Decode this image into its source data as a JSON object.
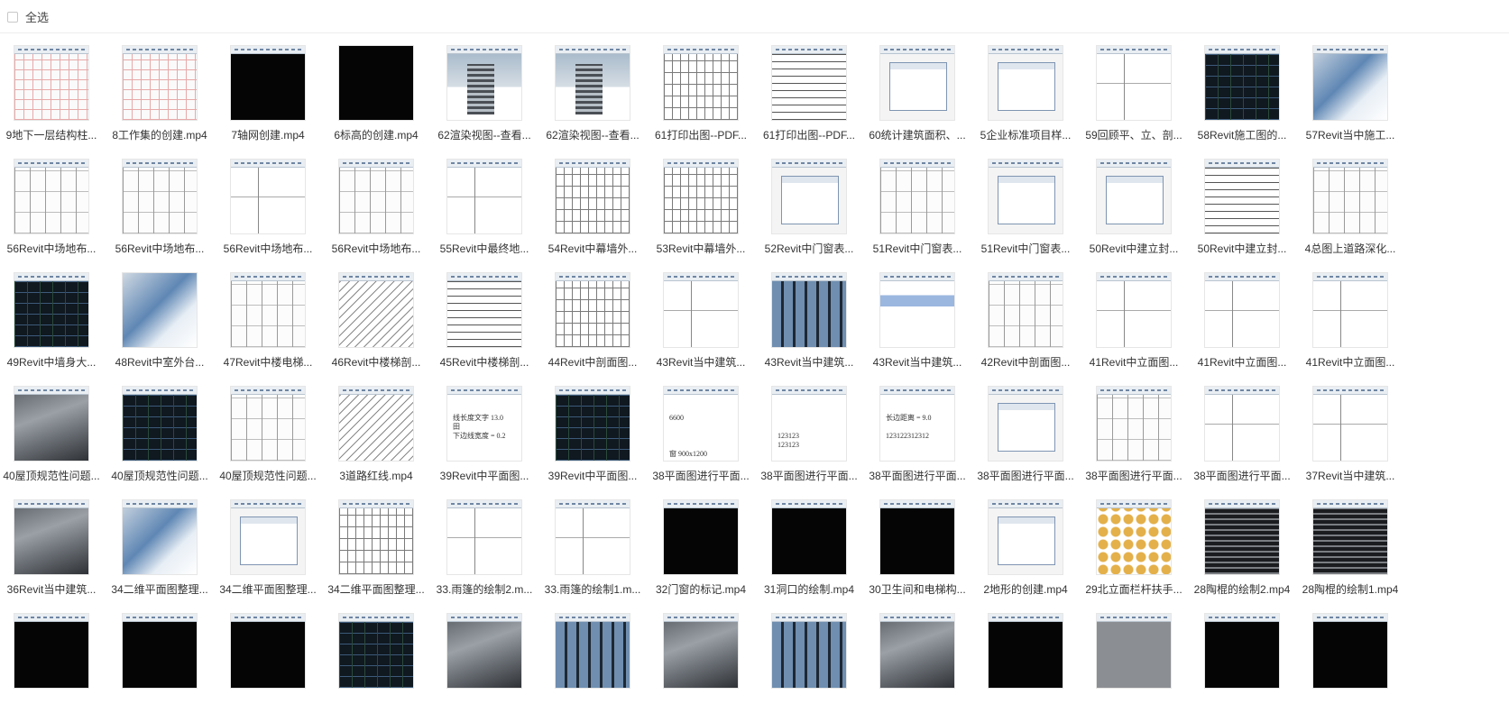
{
  "toolbar": {
    "select_all": "全选"
  },
  "files": [
    {
      "name": "9地下一层结构柱...",
      "thumb": "t-grid",
      "tb": 1
    },
    {
      "name": "8工作集的创建.mp4",
      "thumb": "t-grid",
      "tb": 1
    },
    {
      "name": "7轴网创建.mp4",
      "thumb": "t-black",
      "tb": 1
    },
    {
      "name": "6标高的创建.mp4",
      "thumb": "t-black",
      "tb": 0
    },
    {
      "name": "62渲染视图--查看...",
      "thumb": "t-building",
      "tb": 1
    },
    {
      "name": "62渲染视图--查看...",
      "thumb": "t-building",
      "tb": 1
    },
    {
      "name": "61打印出图--PDF...",
      "thumb": "t-section",
      "tb": 1
    },
    {
      "name": "61打印出图--PDF...",
      "thumb": "t-list",
      "tb": 1
    },
    {
      "name": "60统计建筑面积、...",
      "thumb": "t-dialog",
      "tb": 1
    },
    {
      "name": "5企业标准项目样...",
      "thumb": "t-dialog",
      "tb": 1
    },
    {
      "name": "59回顾平、立、剖...",
      "thumb": "t-lines",
      "tb": 1
    },
    {
      "name": "58Revit施工图的...",
      "thumb": "t-darkplan",
      "tb": 1
    },
    {
      "name": "57Revit当中施工...",
      "thumb": "t-3d",
      "tb": 1
    },
    {
      "name": "56Revit中场地布...",
      "thumb": "t-plan",
      "tb": 1
    },
    {
      "name": "56Revit中场地布...",
      "thumb": "t-plan",
      "tb": 1
    },
    {
      "name": "56Revit中场地布...",
      "thumb": "t-lines",
      "tb": 1
    },
    {
      "name": "56Revit中场地布...",
      "thumb": "t-plan",
      "tb": 1
    },
    {
      "name": "55Revit中最终地...",
      "thumb": "t-lines",
      "tb": 1
    },
    {
      "name": "54Revit中幕墙外...",
      "thumb": "t-section",
      "tb": 1
    },
    {
      "name": "53Revit中幕墙外...",
      "thumb": "t-section",
      "tb": 1
    },
    {
      "name": "52Revit中门窗表...",
      "thumb": "t-dialog",
      "tb": 1
    },
    {
      "name": "51Revit中门窗表...",
      "thumb": "t-plan",
      "tb": 1
    },
    {
      "name": "51Revit中门窗表...",
      "thumb": "t-dialog",
      "tb": 1
    },
    {
      "name": "50Revit中建立封...",
      "thumb": "t-dialog",
      "tb": 1
    },
    {
      "name": "50Revit中建立封...",
      "thumb": "t-list",
      "tb": 1
    },
    {
      "name": "4总图上道路深化...",
      "thumb": "t-plan",
      "tb": 1
    },
    {
      "name": "49Revit中墙身大...",
      "thumb": "t-darkplan",
      "tb": 1
    },
    {
      "name": "48Revit中室外台...",
      "thumb": "t-3d",
      "tb": 0
    },
    {
      "name": "47Revit中楼电梯...",
      "thumb": "t-plan",
      "tb": 1
    },
    {
      "name": "46Revit中楼梯剖...",
      "thumb": "t-stair",
      "tb": 1
    },
    {
      "name": "45Revit中楼梯剖...",
      "thumb": "t-list",
      "tb": 1
    },
    {
      "name": "44Revit中剖面图...",
      "thumb": "t-section",
      "tb": 1
    },
    {
      "name": "43Revit当中建筑...",
      "thumb": "t-lines",
      "tb": 1
    },
    {
      "name": "43Revit当中建筑...",
      "thumb": "t-facade",
      "tb": 1
    },
    {
      "name": "43Revit当中建筑...",
      "thumb": "t-blue",
      "tb": 1
    },
    {
      "name": "42Revit中剖面图...",
      "thumb": "t-plan",
      "tb": 1
    },
    {
      "name": "41Revit中立面图...",
      "thumb": "t-lines",
      "tb": 1
    },
    {
      "name": "41Revit中立面图...",
      "thumb": "t-lines",
      "tb": 1
    },
    {
      "name": "41Revit中立面图...",
      "thumb": "t-lines",
      "tb": 1
    },
    {
      "name": "40屋顶规范性问题...",
      "thumb": "t-gray3d",
      "tb": 1
    },
    {
      "name": "40屋顶规范性问题...",
      "thumb": "t-darkplan",
      "tb": 1
    },
    {
      "name": "40屋顶规范性问题...",
      "thumb": "t-plan",
      "tb": 1
    },
    {
      "name": "3道路红线.mp4",
      "thumb": "t-stair",
      "tb": 1
    },
    {
      "name": "39Revit中平面图...",
      "thumb": "t-text",
      "tb": 1,
      "text": "线长度文字 13.0\n田\n下边线宽度 = 0.2"
    },
    {
      "name": "39Revit中平面图...",
      "thumb": "t-darkplan",
      "tb": 1
    },
    {
      "name": "38平面图进行平面...",
      "thumb": "t-text",
      "tb": 1,
      "text": "6600\n\n\n\n窗 900x1200"
    },
    {
      "name": "38平面图进行平面...",
      "thumb": "t-text",
      "tb": 1,
      "text": "\n\n123123\n123123"
    },
    {
      "name": "38平面图进行平面...",
      "thumb": "t-text",
      "tb": 1,
      "text": "长边距离 = 9.0\n\n123122312312"
    },
    {
      "name": "38平面图进行平面...",
      "thumb": "t-dialog",
      "tb": 1
    },
    {
      "name": "38平面图进行平面...",
      "thumb": "t-plan",
      "tb": 1
    },
    {
      "name": "38平面图进行平面...",
      "thumb": "t-lines",
      "tb": 1
    },
    {
      "name": "37Revit当中建筑...",
      "thumb": "t-lines",
      "tb": 1
    },
    {
      "name": "36Revit当中建筑...",
      "thumb": "t-gray3d",
      "tb": 1
    },
    {
      "name": "34二维平面图整理...",
      "thumb": "t-3d",
      "tb": 1
    },
    {
      "name": "34二维平面图整理...",
      "thumb": "t-dialog",
      "tb": 1
    },
    {
      "name": "34二维平面图整理...",
      "thumb": "t-section",
      "tb": 1
    },
    {
      "name": "33.雨篷的绘制2.m...",
      "thumb": "t-lines",
      "tb": 1
    },
    {
      "name": "33.雨篷的绘制1.m...",
      "thumb": "t-lines",
      "tb": 1
    },
    {
      "name": "32门窗的标记.mp4",
      "thumb": "t-black",
      "tb": 1
    },
    {
      "name": "31洞口的绘制.mp4",
      "thumb": "t-black",
      "tb": 1
    },
    {
      "name": "30卫生间和电梯构...",
      "thumb": "t-black",
      "tb": 1
    },
    {
      "name": "2地形的创建.mp4",
      "thumb": "t-dialog",
      "tb": 1
    },
    {
      "name": "29北立面栏杆扶手...",
      "thumb": "t-folder",
      "tb": 1
    },
    {
      "name": "28陶棍的绘制2.mp4",
      "thumb": "t-bars",
      "tb": 1
    },
    {
      "name": "28陶棍的绘制1.mp4",
      "thumb": "t-bars",
      "tb": 1
    },
    {
      "name": "",
      "thumb": "t-black",
      "tb": 1
    },
    {
      "name": "",
      "thumb": "t-black",
      "tb": 1
    },
    {
      "name": "",
      "thumb": "t-black",
      "tb": 1
    },
    {
      "name": "",
      "thumb": "t-darkplan",
      "tb": 1
    },
    {
      "name": "",
      "thumb": "t-gray3d",
      "tb": 1
    },
    {
      "name": "",
      "thumb": "t-facade",
      "tb": 1
    },
    {
      "name": "",
      "thumb": "t-gray3d",
      "tb": 1
    },
    {
      "name": "",
      "thumb": "t-facade",
      "tb": 1
    },
    {
      "name": "",
      "thumb": "t-gray3d",
      "tb": 1
    },
    {
      "name": "",
      "thumb": "t-black",
      "tb": 1
    },
    {
      "name": "",
      "thumb": "t-gray",
      "tb": 1
    },
    {
      "name": "",
      "thumb": "t-black",
      "tb": 1
    },
    {
      "name": "",
      "thumb": "t-black",
      "tb": 1
    }
  ]
}
